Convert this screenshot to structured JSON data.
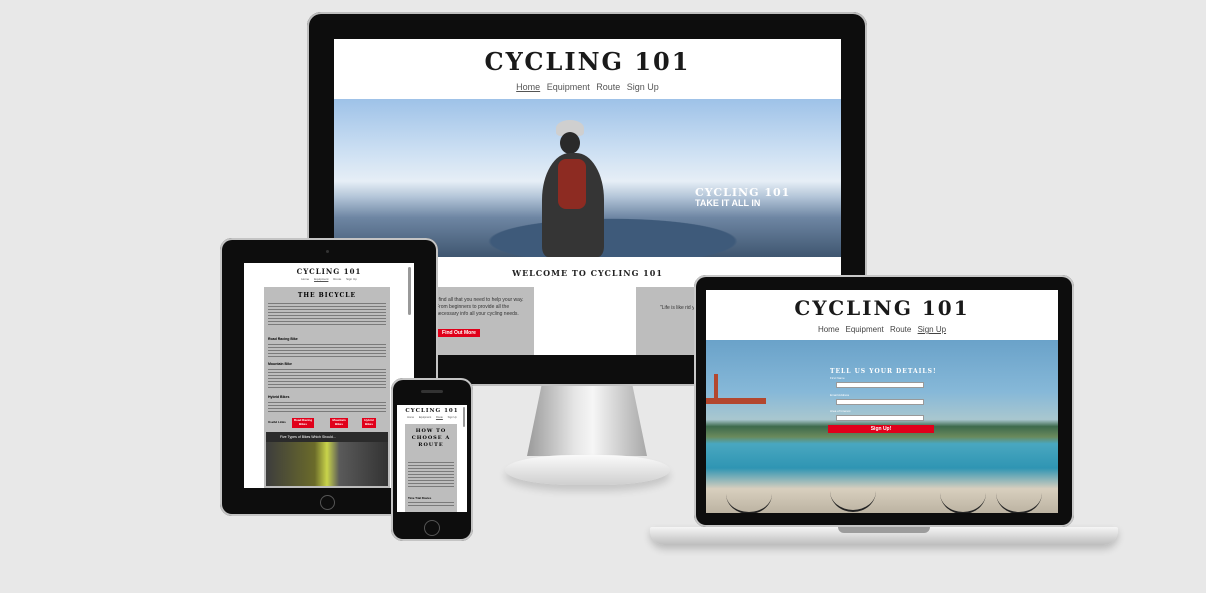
{
  "site": {
    "title": "CYCLING 101",
    "nav": {
      "home": "Home",
      "equipment": "Equipment",
      "route": "Route",
      "signup": "Sign Up"
    }
  },
  "desktop": {
    "hero_heading": "CYCLING 101",
    "hero_subheading": "TAKE IT ALL IN",
    "welcome": "WELCOME TO CYCLING 101",
    "card1_text": "l find all that you need to help your way. From beginners to provide all the necessary info all your cycling needs.",
    "card1_button": "Find Out More",
    "card2_text": "\"Life is like rid your balance"
  },
  "laptop": {
    "form_heading": "TELL US YOUR DETAILS!",
    "field_first": "First Name",
    "field_email": "Email Address",
    "field_area": "Area of Interest",
    "submit": "Sign Up!"
  },
  "tablet": {
    "section_heading": "THE BICYCLE",
    "road": "Road Racing Bike",
    "mountain": "Mountain Bike",
    "hybrid": "Hybrid Bikes",
    "useful": "Useful Links",
    "link1": "Road Racing Bikes",
    "link2": "Mountain Bikes",
    "link3": "Hybrid Bikes",
    "video_title": "Five Types of Bikes Which Should..."
  },
  "phone": {
    "section_heading": "HOW TO CHOOSE A ROUTE",
    "subhead": "Time Trial Routes"
  },
  "colors": {
    "accent": "#e0001a",
    "bezel": "#0d0d0d",
    "background": "#e8e8e8"
  }
}
